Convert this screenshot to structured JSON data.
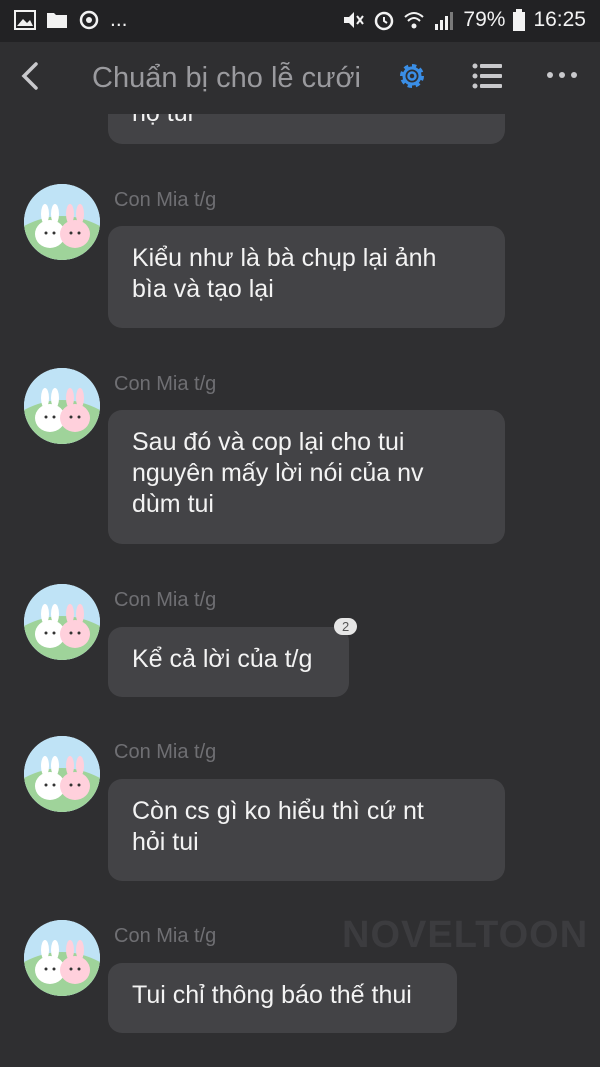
{
  "status_bar": {
    "battery": "79%",
    "time": "16:25",
    "overflow": "..."
  },
  "header": {
    "title": "Chuẩn bị cho lễ cưới"
  },
  "messages": [
    {
      "text": "họ tui"
    },
    {
      "sender": "Con Mia t/g",
      "text_lines": [
        "Kiểu như là bà chụp lại ảnh",
        "bìa và tạo lại"
      ]
    },
    {
      "sender": "Con Mia t/g",
      "text_lines": [
        "Sau đó và cop lại cho tui",
        "nguyên mấy lời nói của nv",
        "dùm tui"
      ]
    },
    {
      "sender": "Con Mia t/g",
      "text": "Kể cả lời của t/g",
      "comment_count": "2"
    },
    {
      "sender": "Con Mia t/g",
      "text_lines": [
        "Còn cs gì ko hiểu thì cứ nt",
        "hỏi tui"
      ]
    },
    {
      "sender": "Con Mia t/g",
      "text": "Tui chỉ thông báo thế thui"
    }
  ],
  "watermark": "NOVELTOON",
  "colors": {
    "accent": "#3a8ee6",
    "background": "#2f2f31",
    "bubble": "#434346",
    "sender": "#6f6f73"
  }
}
